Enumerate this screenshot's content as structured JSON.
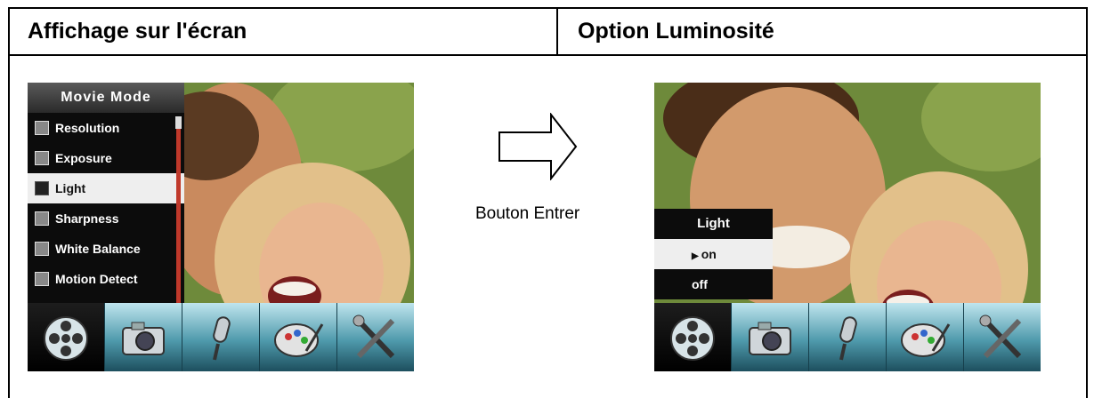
{
  "header": {
    "left_title": "Affichage sur l'écran",
    "right_title": "Option Luminosité"
  },
  "left_screen": {
    "menu_title": "Movie Mode",
    "menu_items": [
      {
        "label": "Resolution",
        "icon": "resolution-icon"
      },
      {
        "label": "Exposure",
        "icon": "exposure-icon"
      },
      {
        "label": "Light",
        "icon": "light-icon",
        "selected": true
      },
      {
        "label": "Sharpness",
        "icon": "sharpness-icon"
      },
      {
        "label": "White Balance",
        "icon": "white-balance-icon"
      },
      {
        "label": "Motion Detect",
        "icon": "motion-detect-icon"
      }
    ]
  },
  "arrow_label": "Bouton Entrer",
  "right_screen": {
    "submenu_title": "Light",
    "options": [
      {
        "label": "on",
        "selected": true
      },
      {
        "label": "off",
        "selected": false
      }
    ]
  },
  "tabs": [
    "movie-reel-icon",
    "camera-icon",
    "microphone-icon",
    "palette-icon",
    "tools-icon"
  ],
  "colors": {
    "menu_bg": "#0c0c0c",
    "selection": "#eeeeee",
    "tab_bar": "#4f9aac",
    "scrollbar": "#c0392b"
  }
}
